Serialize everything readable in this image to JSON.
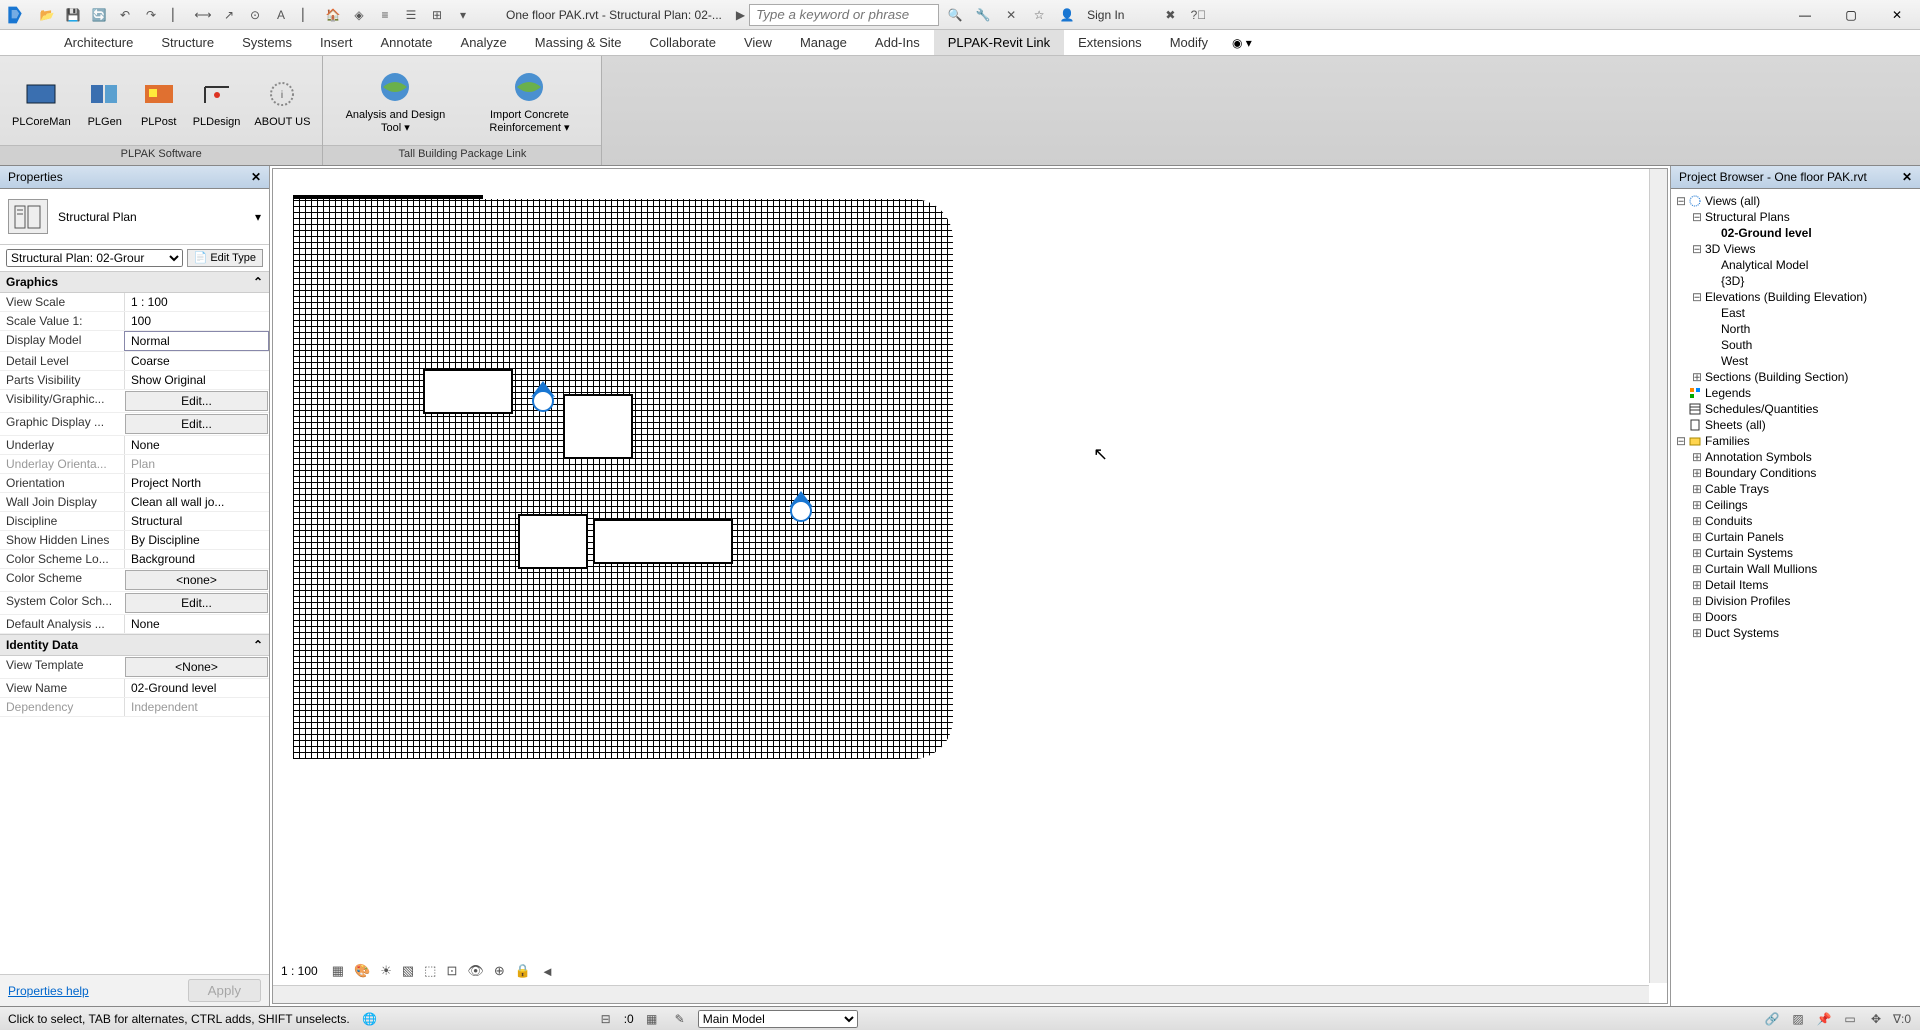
{
  "titlebar": {
    "doc_title": "One floor PAK.rvt - Structural Plan: 02-...",
    "search_placeholder": "Type a keyword or phrase",
    "sign_in": "Sign In"
  },
  "tabs": {
    "items": [
      "Architecture",
      "Structure",
      "Systems",
      "Insert",
      "Annotate",
      "Analyze",
      "Massing & Site",
      "Collaborate",
      "View",
      "Manage",
      "Add-Ins",
      "PLPAK-Revit Link",
      "Extensions",
      "Modify"
    ],
    "active": "PLPAK-Revit Link"
  },
  "ribbon": {
    "panel1": {
      "title": "PLPAK Software",
      "btns": [
        "PLCoreMan",
        "PLGen",
        "PLPost",
        "PLDesign",
        "ABOUT US"
      ]
    },
    "panel2": {
      "title": "Tall Building Package Link",
      "btns": [
        "Analysis and Design Tool",
        "Import Concrete Reinforcement"
      ]
    }
  },
  "properties": {
    "title": "Properties",
    "type_name": "Structural Plan",
    "instance": "Structural Plan: 02-Grour",
    "edit_type": "Edit Type",
    "groups": [
      {
        "name": "Graphics",
        "rows": [
          {
            "k": "View Scale",
            "v": "1 : 100"
          },
          {
            "k": "Scale Value    1:",
            "v": "100"
          },
          {
            "k": "Display Model",
            "v": "Normal",
            "hl": true
          },
          {
            "k": "Detail Level",
            "v": "Coarse"
          },
          {
            "k": "Parts Visibility",
            "v": "Show Original"
          },
          {
            "k": "Visibility/Graphic...",
            "v": "Edit...",
            "btn": true
          },
          {
            "k": "Graphic Display ...",
            "v": "Edit...",
            "btn": true
          },
          {
            "k": "Underlay",
            "v": "None"
          },
          {
            "k": "Underlay Orienta...",
            "v": "Plan",
            "dim": true
          },
          {
            "k": "Orientation",
            "v": "Project North"
          },
          {
            "k": "Wall Join Display",
            "v": "Clean all wall jo..."
          },
          {
            "k": "Discipline",
            "v": "Structural"
          },
          {
            "k": "Show Hidden Lines",
            "v": "By Discipline"
          },
          {
            "k": "Color Scheme Lo...",
            "v": "Background"
          },
          {
            "k": "Color Scheme",
            "v": "<none>",
            "btn": true
          },
          {
            "k": "System Color Sch...",
            "v": "Edit...",
            "btn": true
          },
          {
            "k": "Default Analysis ...",
            "v": "None"
          }
        ]
      },
      {
        "name": "Identity Data",
        "rows": [
          {
            "k": "View Template",
            "v": "<None>",
            "btn": true
          },
          {
            "k": "View Name",
            "v": "02-Ground level"
          },
          {
            "k": "Dependency",
            "v": "Independent",
            "dim": true
          }
        ]
      }
    ],
    "help": "Properties help",
    "apply": "Apply"
  },
  "viewbar": {
    "scale": "1 : 100"
  },
  "browser": {
    "title": "Project Browser - One floor PAK.rvt",
    "tree": [
      {
        "d": 0,
        "c": "−",
        "ico": "circle",
        "t": "Views (all)"
      },
      {
        "d": 1,
        "c": "−",
        "t": "Structural Plans"
      },
      {
        "d": 2,
        "c": "",
        "t": "02-Ground level",
        "sel": true
      },
      {
        "d": 1,
        "c": "−",
        "t": "3D Views"
      },
      {
        "d": 2,
        "c": "",
        "t": "Analytical Model"
      },
      {
        "d": 2,
        "c": "",
        "t": "{3D}"
      },
      {
        "d": 1,
        "c": "−",
        "t": "Elevations (Building Elevation)"
      },
      {
        "d": 2,
        "c": "",
        "t": "East"
      },
      {
        "d": 2,
        "c": "",
        "t": "North"
      },
      {
        "d": 2,
        "c": "",
        "t": "South"
      },
      {
        "d": 2,
        "c": "",
        "t": "West"
      },
      {
        "d": 1,
        "c": "+",
        "t": "Sections (Building Section)"
      },
      {
        "d": 0,
        "c": "",
        "ico": "legend",
        "t": "Legends"
      },
      {
        "d": 0,
        "c": "",
        "ico": "sched",
        "t": "Schedules/Quantities"
      },
      {
        "d": 0,
        "c": "",
        "ico": "sheet",
        "t": "Sheets (all)"
      },
      {
        "d": 0,
        "c": "−",
        "ico": "fam",
        "t": "Families"
      },
      {
        "d": 1,
        "c": "+",
        "t": "Annotation Symbols"
      },
      {
        "d": 1,
        "c": "+",
        "t": "Boundary Conditions"
      },
      {
        "d": 1,
        "c": "+",
        "t": "Cable Trays"
      },
      {
        "d": 1,
        "c": "+",
        "t": "Ceilings"
      },
      {
        "d": 1,
        "c": "+",
        "t": "Conduits"
      },
      {
        "d": 1,
        "c": "+",
        "t": "Curtain Panels"
      },
      {
        "d": 1,
        "c": "+",
        "t": "Curtain Systems"
      },
      {
        "d": 1,
        "c": "+",
        "t": "Curtain Wall Mullions"
      },
      {
        "d": 1,
        "c": "+",
        "t": "Detail Items"
      },
      {
        "d": 1,
        "c": "+",
        "t": "Division Profiles"
      },
      {
        "d": 1,
        "c": "+",
        "t": "Doors"
      },
      {
        "d": 1,
        "c": "+",
        "t": "Duct Systems"
      }
    ]
  },
  "statusbar": {
    "msg": "Click to select, TAB for alternates, CTRL adds, SHIFT unselects.",
    "sel_count": ":0",
    "main_model": "Main Model"
  }
}
